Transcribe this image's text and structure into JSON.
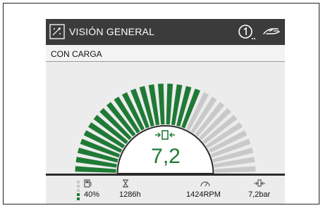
{
  "header": {
    "title": "VISIÓN GENERAL",
    "title_icon": "overview-icon",
    "mode_icon": "circled-one-icon",
    "hand_icon": "hand-icon"
  },
  "subheader": {
    "label": "CON CARGA"
  },
  "gauge": {
    "value": "7,2",
    "icon": "pressure-icon",
    "level": 0.64,
    "colors": {
      "active": "#1f7a35",
      "inactive": "#c9c9c9"
    }
  },
  "footer": {
    "fuel": {
      "value": "40%",
      "icon": "fuel-icon",
      "level": 0.4
    },
    "hours": {
      "value": "1286h",
      "icon": "hourglass-icon"
    },
    "rpm": {
      "value": "1424RPM",
      "icon": "speedometer-icon"
    },
    "pressure": {
      "value": "7,2bar",
      "icon": "pressure-icon"
    }
  }
}
